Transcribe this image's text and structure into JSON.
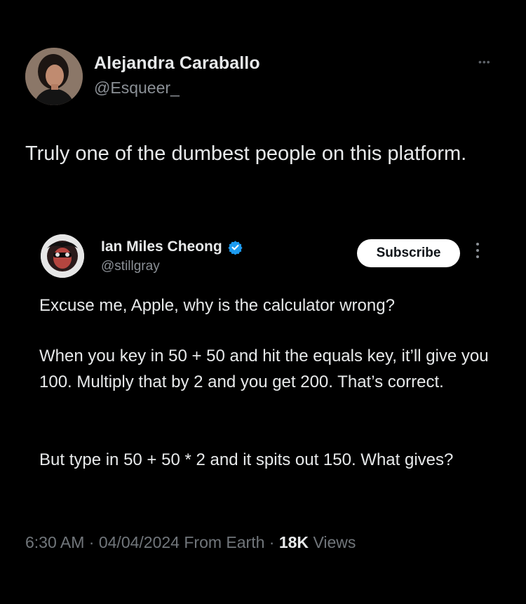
{
  "author": {
    "name": "Alejandra Caraballo",
    "handle": "@Esqueer_"
  },
  "more_menu_glyph": "•••",
  "tweet_text": "Truly one of the dumbest people on this platform.",
  "quoted": {
    "name": "Ian Miles Cheong",
    "handle": "@stillgray",
    "subscribe_label": "Subscribe",
    "paragraphs": [
      "Excuse me, Apple, why is the calculator wrong?",
      "When you key in 50 + 50 and hit the equals key, it’ll give you 100. Multiply that by 2 and you get 200. That’s correct.",
      "But type in 50 + 50 * 2 and it spits out 150. What gives?"
    ]
  },
  "meta": {
    "time": "6:30 AM",
    "date": "04/04/2024",
    "source": "From Earth",
    "separator": "·",
    "views_count": "18K",
    "views_label": "Views"
  },
  "colors": {
    "background": "#000000",
    "text_primary": "#e7e9ea",
    "text_secondary": "#71767b",
    "verified_blue": "#1d9bf0",
    "button_bg": "#ffffff"
  }
}
